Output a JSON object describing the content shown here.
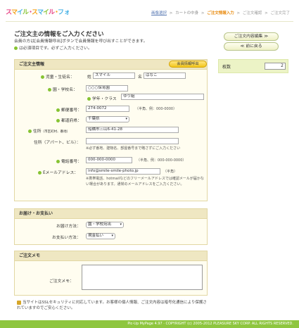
{
  "logo": {
    "text": "スマイル・スマイル・フォト"
  },
  "breadcrumb": {
    "step1": "画像選択",
    "step2": "カートの中身",
    "step3": "ご注文情報入力",
    "step4": "ご注文確認",
    "step5": "ご注文完了",
    "sep": ">"
  },
  "page": {
    "title": "ご注文主の情報をご入力ください",
    "intro1": "会員の方は[会員情報呼出]ボタンで会員情報を呼び出すことができます。",
    "intro2": "は必須項目です。必ずご入力ください。"
  },
  "side": {
    "edit_button": "ご注文内容編集 ≫",
    "back_button": "≪ 前に戻る",
    "qty_label": "枚数",
    "qty_value": "2"
  },
  "orderer": {
    "header": "ご注文主情報",
    "member_button": "会員情報呼出",
    "name_label": "児童・生徒名：",
    "surname_prefix": "姓",
    "surname": "スマイル",
    "given_prefix": "名",
    "given": "はなこ",
    "school_label": "園・学校名：",
    "school": "○○○保育園",
    "class_label": "学年・クラス",
    "class": "ゆり組",
    "zip_label": "郵便番号：",
    "zip": "274-0072",
    "zip_note": "（半角、例：000-0000）",
    "pref_label": "都道府県：",
    "pref": "千葉県",
    "addr_label": "住所",
    "addr_sub": "（市区町村、番地）",
    "addr": "船橋市三山6-41-28",
    "addr2_label": "住所（アパート、ビル）：",
    "addr2": "",
    "addr_note": "※必ず番地、建物名、部屋番号まで略さずにご入力ください",
    "tel_label": "電話番号：",
    "tel": "000-000-0000",
    "tel_note": "（半角、例：000-000-0000）",
    "email_label": "Eメールアドレス：",
    "email": "info@smile-smile-photo.jp",
    "email_note": "（半角）",
    "email_note2": "※携帯電話、hotmailなどのフリーメールアドレスでは確認メールが届かない場合があります。通常のメールアドレスをご入力ください。"
  },
  "delivery": {
    "header": "お届け・お支払い",
    "ship_label": "お届け方法：",
    "ship_value": "園・学校宛出",
    "pay_label": "お支払い方法：",
    "pay_value": "現金払い"
  },
  "memo": {
    "header": "ご注文メモ",
    "label": "ご注文メモ："
  },
  "footer": {
    "ssl_note": "当サイトはSSLセキュリティに対応しています。お客様の個人情報、ご注文内容は暗号化通信により保護されていますのでご安心ください。",
    "copyright": "Pic-Up MyPage 4.97 · COPYRIGHT (c) 2005-2012 PLEASURE SKY CORP. ALL RIGHTS RESERVED."
  },
  "colors": {
    "accent_green": "#86c332",
    "accent_orange": "#e8890c",
    "section_bg": "#efe7c2"
  }
}
